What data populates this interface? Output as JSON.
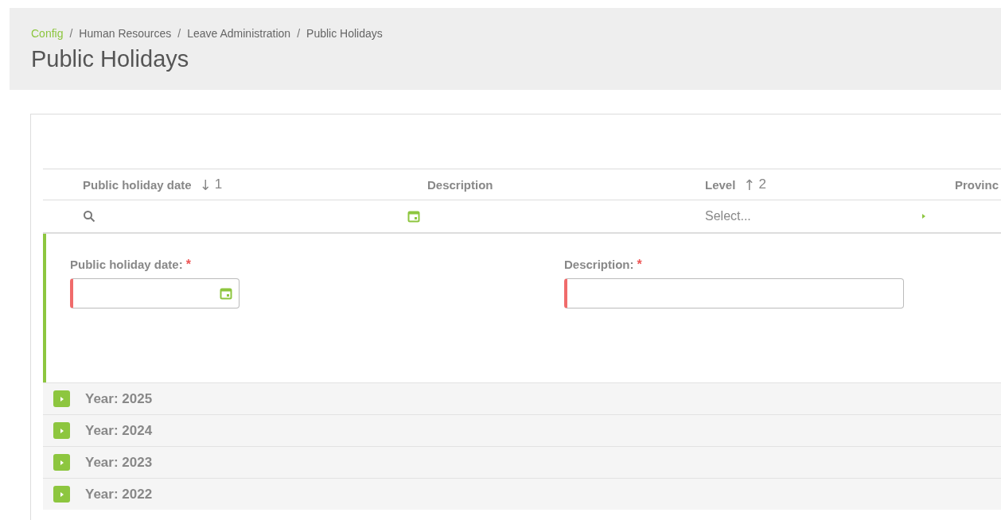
{
  "breadcrumb": [
    {
      "label": "Config",
      "link": true
    },
    {
      "label": "Human Resources",
      "link": false
    },
    {
      "label": "Leave Administration",
      "link": false
    },
    {
      "label": "Public Holidays",
      "link": false
    }
  ],
  "breadcrumb_separator": "/",
  "page_title": "Public Holidays",
  "table": {
    "columns": [
      {
        "label": "Public holiday date",
        "sort_arrow": "↓",
        "sort_order": "1"
      },
      {
        "label": "Description"
      },
      {
        "label": "Level",
        "sort_arrow": "↑",
        "sort_order": "2"
      },
      {
        "label": "Provinc"
      }
    ],
    "filters": [
      {
        "kind": "search"
      },
      {
        "kind": "date"
      },
      {
        "kind": "select",
        "placeholder": "Select..."
      }
    ],
    "form": {
      "fields": [
        {
          "label": "Public holiday date:",
          "required_mark": "*",
          "kind": "date"
        },
        {
          "label": "Description:",
          "required_mark": "*",
          "kind": "text"
        }
      ]
    },
    "groups": [
      {
        "label": "Year: 2025",
        "expanded": false
      },
      {
        "label": "Year: 2024",
        "expanded": false
      },
      {
        "label": "Year: 2023",
        "expanded": false
      },
      {
        "label": "Year: 2022",
        "expanded": false
      }
    ]
  }
}
